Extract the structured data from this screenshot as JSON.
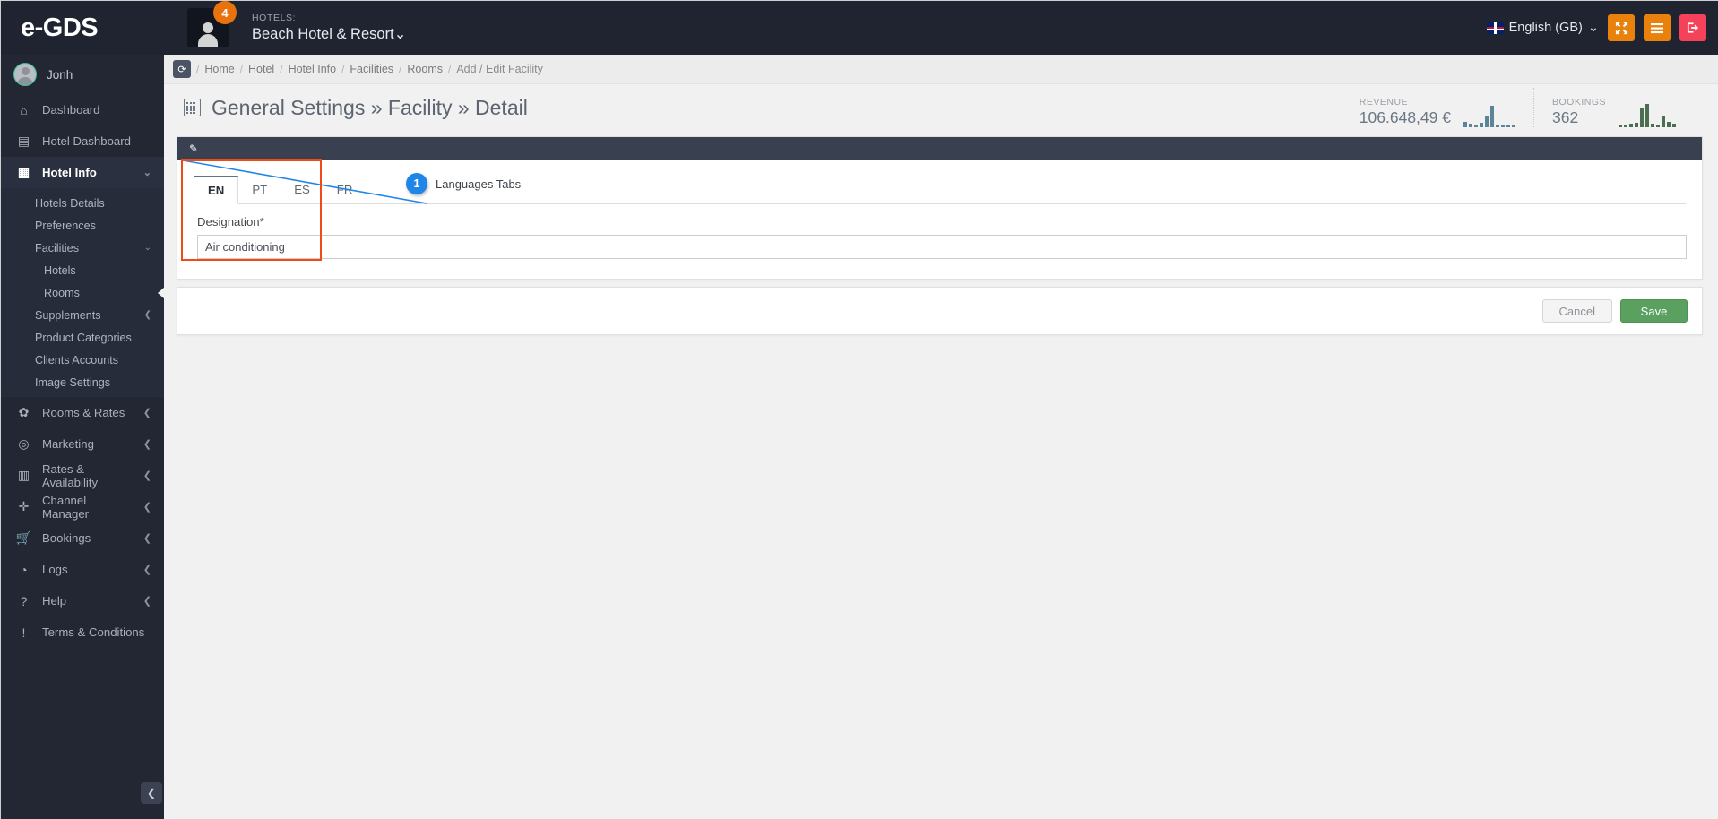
{
  "header": {
    "brand": "e-GDS",
    "notification_count": "4",
    "hotels_label": "HOTELS:",
    "hotel_name": "Beach Hotel & Resort",
    "hotel_caret": "⌄",
    "language": "English (GB)",
    "language_caret": "⌄",
    "fullscreen_icon": "✥",
    "menu_icon": "☰",
    "logout_icon": "➔"
  },
  "sidebar": {
    "user": "Jonh",
    "collapse_icon": "❮",
    "items": [
      {
        "label": "Dashboard",
        "icon": "⌂",
        "icon_name": "home-icon",
        "active": false,
        "caret": ""
      },
      {
        "label": "Hotel Dashboard",
        "icon": "▤",
        "icon_name": "dashboard-icon",
        "active": false,
        "caret": ""
      },
      {
        "label": "Hotel Info",
        "icon": "▦",
        "icon_name": "building-icon",
        "active": true,
        "caret": "⌄"
      }
    ],
    "sub_items": [
      {
        "label": "Hotels Details",
        "level": 1,
        "caret": "",
        "selected": false
      },
      {
        "label": "Preferences",
        "level": 1,
        "caret": "",
        "selected": false
      },
      {
        "label": "Facilities",
        "level": 1,
        "caret": "⌄",
        "selected": false
      },
      {
        "label": "Hotels",
        "level": 2,
        "caret": "",
        "selected": false
      },
      {
        "label": "Rooms",
        "level": 2,
        "caret": "",
        "selected": true
      },
      {
        "label": "Supplements",
        "level": 1,
        "caret": "❮",
        "selected": false
      },
      {
        "label": "Product Categories",
        "level": 1,
        "caret": "",
        "selected": false
      },
      {
        "label": "Clients Accounts",
        "level": 1,
        "caret": "",
        "selected": false
      },
      {
        "label": "Image Settings",
        "level": 1,
        "caret": "",
        "selected": false
      }
    ],
    "items_bottom": [
      {
        "label": "Rooms & Rates",
        "icon": "✿",
        "icon_name": "gears-icon",
        "caret": "❮"
      },
      {
        "label": "Marketing",
        "icon": "◎",
        "icon_name": "target-icon",
        "caret": "❮"
      },
      {
        "label": "Rates & Availability",
        "icon": "▥",
        "icon_name": "bar-chart-icon",
        "caret": "❮"
      },
      {
        "label": "Channel Manager",
        "icon": "✛",
        "icon_name": "arrows-icon",
        "caret": "❮"
      },
      {
        "label": "Bookings",
        "icon": "🛒",
        "icon_name": "cart-icon",
        "caret": "❮"
      },
      {
        "label": "Logs",
        "icon": "◔",
        "icon_name": "clock-icon",
        "caret": "❮"
      },
      {
        "label": "Help",
        "icon": "?",
        "icon_name": "question-icon",
        "caret": "❮"
      },
      {
        "label": "Terms & Conditions",
        "icon": "!",
        "icon_name": "exclamation-icon",
        "caret": ""
      }
    ]
  },
  "breadcrumb": {
    "refresh_icon": "⟳",
    "items": [
      "Home",
      "Hotel",
      "Hotel Info",
      "Facilities",
      "Rooms",
      "Add / Edit Facility"
    ],
    "separator": "/"
  },
  "page": {
    "title": "General Settings » Facility » Detail"
  },
  "stats": [
    {
      "key": "REVENUE",
      "value": "106.648,49 €",
      "color": "#5b8499",
      "bars": [
        6,
        4,
        3,
        5,
        12,
        24,
        3,
        3,
        3,
        3
      ]
    },
    {
      "key": "BOOKINGS",
      "value": "362",
      "color": "#4a6e4f",
      "bars": [
        3,
        3,
        4,
        5,
        22,
        26,
        4,
        3,
        12,
        6,
        4
      ]
    }
  ],
  "form": {
    "panel_icon": "✎",
    "tabs": [
      {
        "label": "EN",
        "active": true
      },
      {
        "label": "PT",
        "active": false
      },
      {
        "label": "ES",
        "active": false
      },
      {
        "label": "FR",
        "active": false
      }
    ],
    "designation_label": "Designation*",
    "designation_value": "Air conditioning",
    "designation_placeholder": "",
    "cancel_label": "Cancel",
    "save_label": "Save"
  },
  "annotations": [
    {
      "number": "1",
      "caption": "Languages Tabs"
    }
  ],
  "colors": {
    "accent_orange": "#e8820c",
    "logout_red": "#f6415a",
    "save_green": "#5aa05f",
    "annotation_red": "#ef4a17",
    "annotation_blue": "#1f86e8",
    "sidebar_bg": "#222733",
    "topbar_bg": "#1f2430"
  }
}
